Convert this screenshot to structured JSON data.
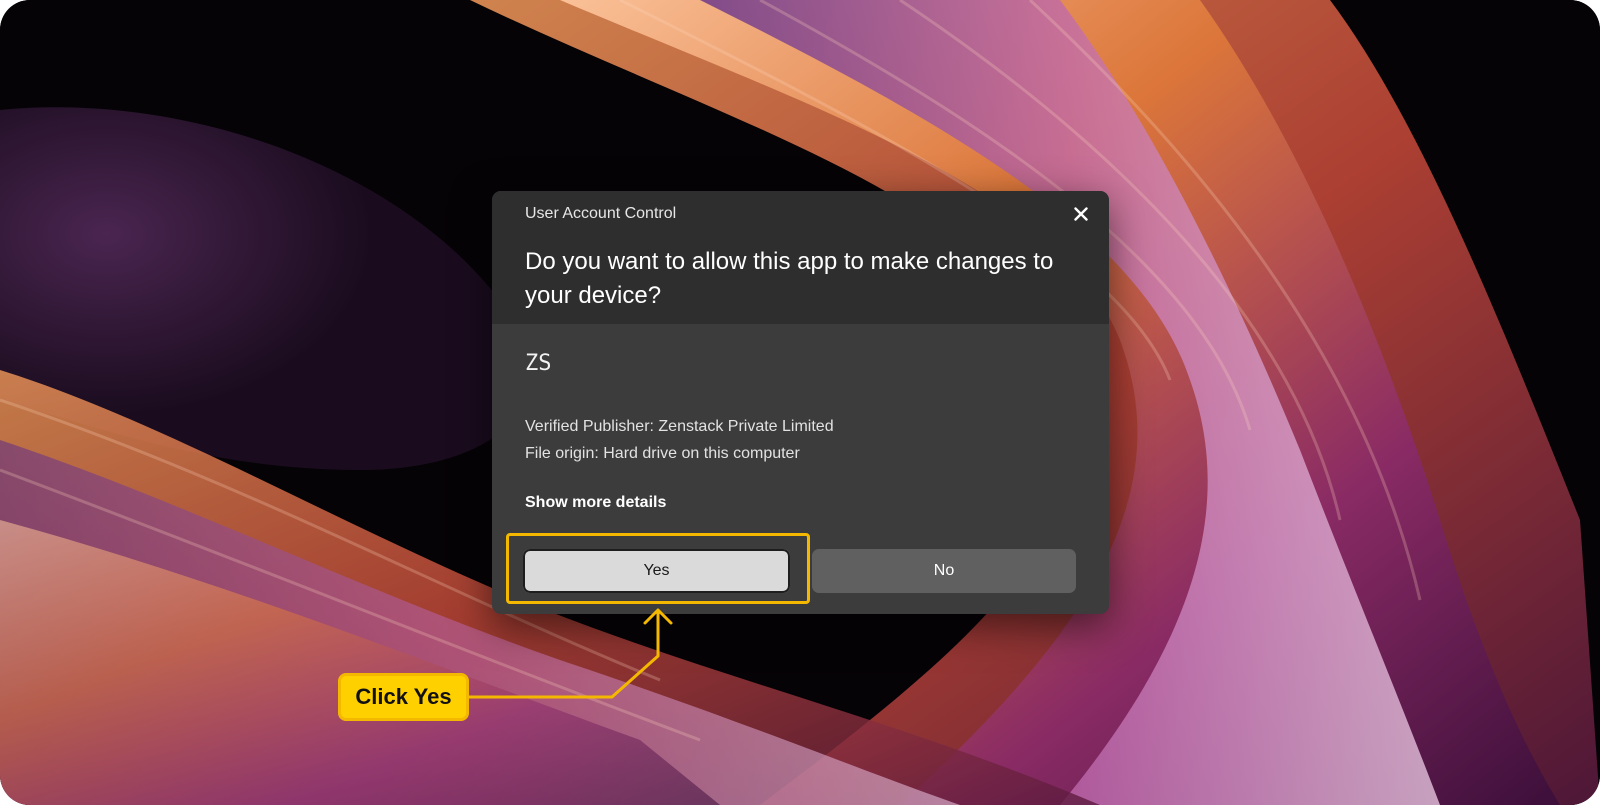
{
  "dialog": {
    "caption": "User Account Control",
    "question": "Do you want to allow this app to make changes to your device?",
    "app_name": "ZS",
    "publisher": "Verified Publisher: Zenstack Private Limited",
    "origin": "File origin: Hard drive on this computer",
    "more_details": "Show more details",
    "yes_label": "Yes",
    "no_label": "No"
  },
  "annotation": {
    "callout_label": "Click Yes",
    "highlight_color": "#f5b800"
  },
  "icons": {
    "close": "close-icon"
  },
  "colors": {
    "dialog_header": "#2e2e2e",
    "dialog_body": "#3c3c3c",
    "yes_button": "#dadada",
    "no_button": "#606060"
  }
}
